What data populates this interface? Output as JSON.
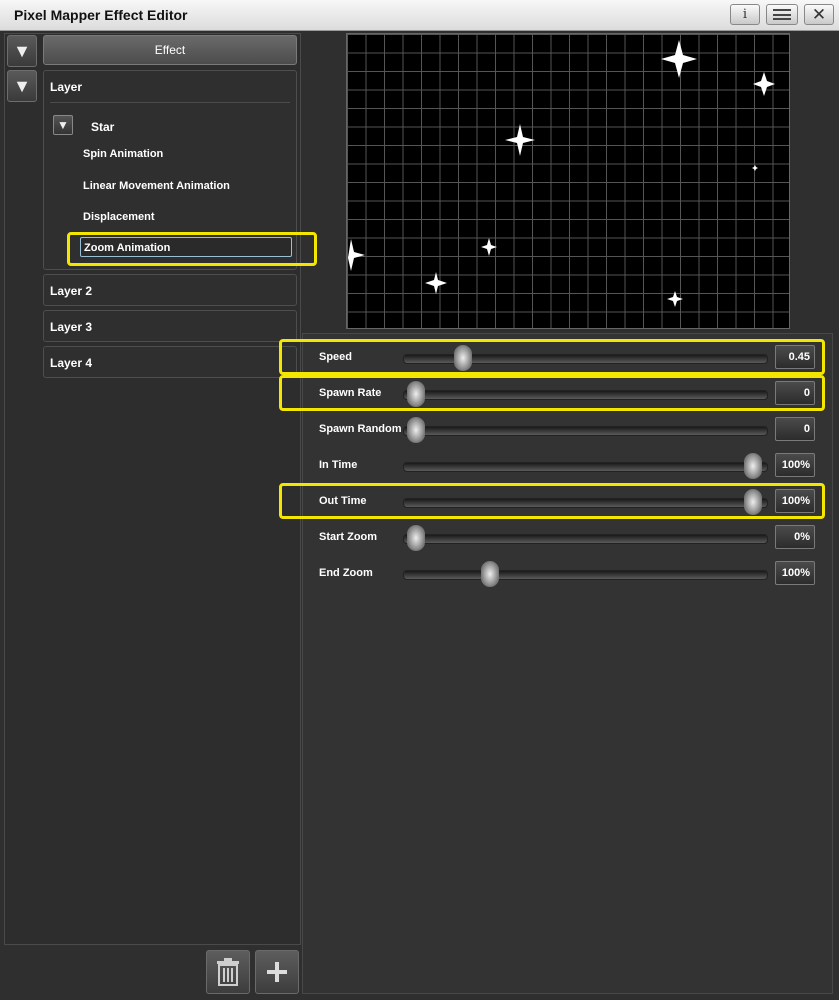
{
  "window": {
    "title": "Pixel Mapper Effect Editor",
    "info_label": "i"
  },
  "left_panel": {
    "effect_label": "Effect",
    "layer_main_label": "Layer",
    "star_label": "Star",
    "tree_items": [
      "Spin Animation",
      "Linear Movement Animation",
      "Displacement",
      "Zoom Animation"
    ],
    "other_layers": [
      "Layer 2",
      "Layer 3",
      "Layer 4"
    ]
  },
  "icons": {
    "collapse": "triangle-down-icon",
    "delete": "trash-icon",
    "add": "plus-icon",
    "info": "info-icon",
    "menu": "menu-icon",
    "close": "close-icon"
  },
  "highlight_color": "#f3e600",
  "sliders": [
    {
      "label": "Speed",
      "value": "0.45",
      "level": 0.14
    },
    {
      "label": "Spawn Rate",
      "value": "0",
      "level": 0.0
    },
    {
      "label": "Spawn Random",
      "value": "0",
      "level": 0.0
    },
    {
      "label": "In Time",
      "value": "100%",
      "level": 1.0
    },
    {
      "label": "Out Time",
      "value": "100%",
      "level": 1.0
    },
    {
      "label": "Start Zoom",
      "value": "0%",
      "level": 0.0
    },
    {
      "label": "End Zoom",
      "value": "100%",
      "level": 0.22
    }
  ]
}
